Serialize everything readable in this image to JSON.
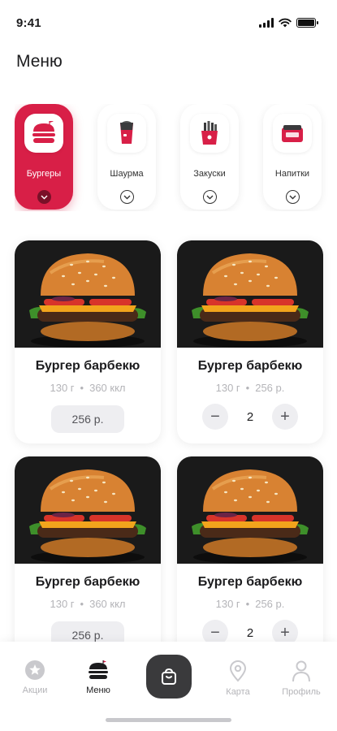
{
  "status": {
    "time": "9:41"
  },
  "page": {
    "title": "Меню"
  },
  "categories": [
    {
      "label": "Бургеры",
      "icon": "burger-icon",
      "active": true
    },
    {
      "label": "Шаурма",
      "icon": "shawarma-icon",
      "active": false
    },
    {
      "label": "Закуски",
      "icon": "fries-icon",
      "active": false
    },
    {
      "label": "Напитки",
      "icon": "drink-box-icon",
      "active": false
    }
  ],
  "products": [
    {
      "title": "Бургер барбекю",
      "weight": "130 г",
      "info": "360 ккл",
      "mode": "price",
      "price": "256 р."
    },
    {
      "title": "Бургер барбекю",
      "weight": "130 г",
      "info": "256 р.",
      "mode": "stepper",
      "quantity": "2"
    },
    {
      "title": "Бургер барбекю",
      "weight": "130 г",
      "info": "360 ккл",
      "mode": "price",
      "price": "256 р."
    },
    {
      "title": "Бургер барбекю",
      "weight": "130 г",
      "info": "256 р.",
      "mode": "stepper",
      "quantity": "2"
    }
  ],
  "meta_separator": "•",
  "stepper": {
    "minus": "−",
    "plus": "+"
  },
  "tabs": [
    {
      "label": "Акции",
      "icon": "star-icon",
      "active": false
    },
    {
      "label": "Меню",
      "icon": "burger-icon",
      "active": true
    },
    {
      "label": "Карта",
      "icon": "map-pin-icon",
      "active": false
    },
    {
      "label": "Профиль",
      "icon": "user-icon",
      "active": false
    }
  ],
  "cart": {
    "icon": "shopping-bag-icon"
  },
  "colors": {
    "accent": "#d81f47",
    "dark": "#3a3a3c",
    "muted": "#b4b4b8"
  }
}
